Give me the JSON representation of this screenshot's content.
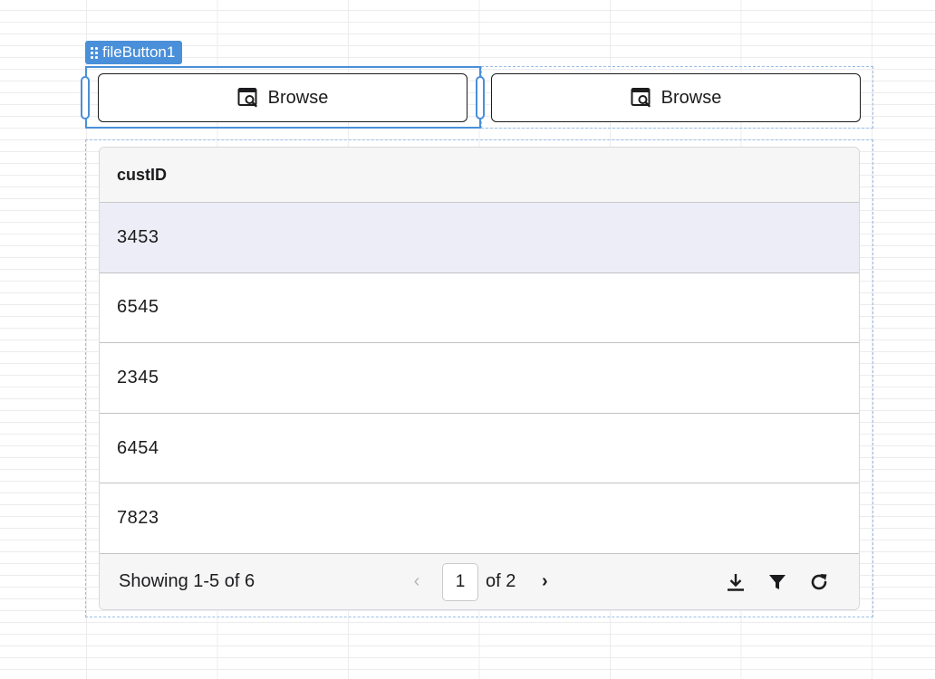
{
  "selection": {
    "widget_name": "fileButton1"
  },
  "buttons": [
    {
      "label": "Browse",
      "icon": "browse-icon"
    },
    {
      "label": "Browse",
      "icon": "browse-icon"
    }
  ],
  "table": {
    "column_header": "custID",
    "rows": [
      "3453",
      "6545",
      "2345",
      "6454",
      "7823"
    ],
    "selected_row": 0
  },
  "footer": {
    "showing_text": "Showing 1-5 of 6",
    "current_page": "1",
    "of_text": "of 2",
    "prev_icon": "chevron-left-icon",
    "next_icon": "chevron-right-icon",
    "tools": [
      "download-icon",
      "filter-icon",
      "refresh-icon"
    ]
  },
  "colors": {
    "selection_accent": "#4a8fd9",
    "selected_row_bg": "#ededf7"
  }
}
